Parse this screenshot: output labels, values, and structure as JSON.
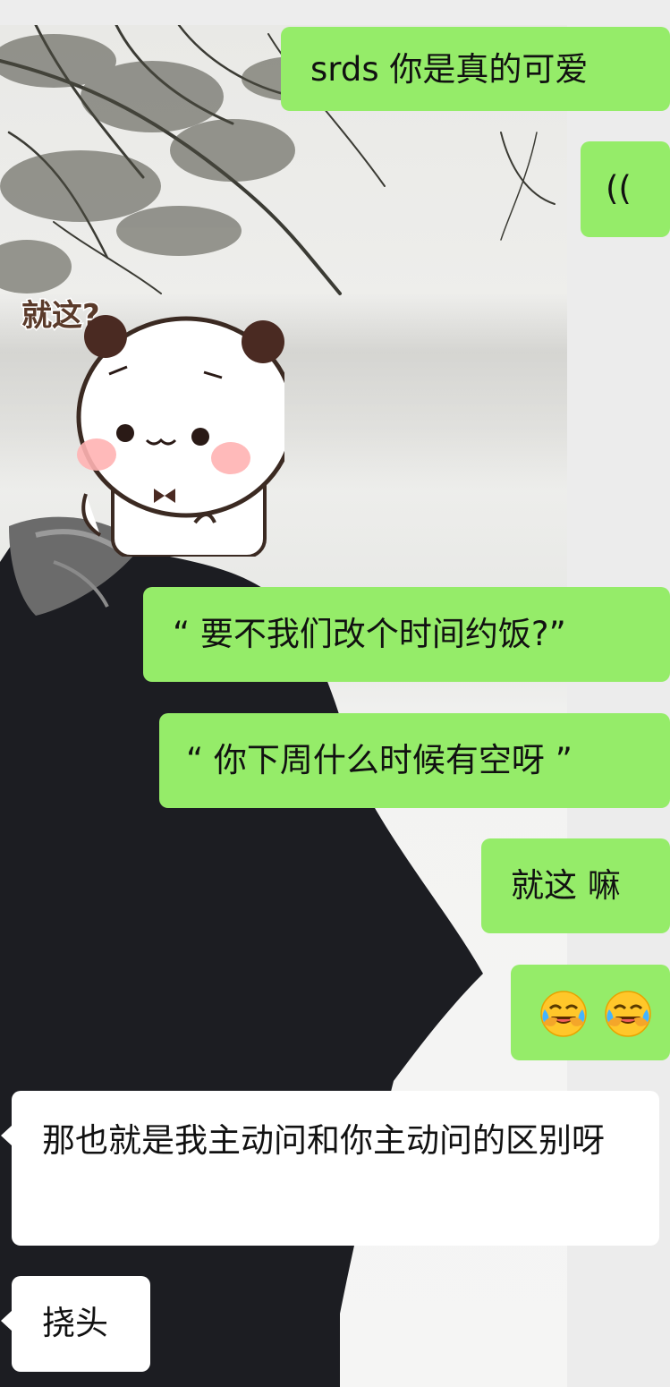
{
  "messages": [
    {
      "id": "m1",
      "side": "out",
      "text": "srds 你是真的可爱"
    },
    {
      "id": "m2",
      "side": "out",
      "text": "(("
    },
    {
      "id": "m3",
      "side": "in",
      "type": "sticker",
      "text": "就这?"
    },
    {
      "id": "m4",
      "side": "out",
      "text": "“ 要不我们改个时间约饭?”"
    },
    {
      "id": "m5",
      "side": "out",
      "text": "“ 你下周什么时候有空呀 ”"
    },
    {
      "id": "m6",
      "side": "out",
      "text": "就这  嘛"
    },
    {
      "id": "m7",
      "side": "out",
      "type": "emoji",
      "emoji": [
        "crying-laughing-face-icon",
        "crying-laughing-face-icon"
      ]
    },
    {
      "id": "m8",
      "side": "in",
      "text": "那也就是我主动问和你主动问的区别呀"
    },
    {
      "id": "m9",
      "side": "in",
      "text": "挠头"
    }
  ],
  "colors": {
    "outgoing_bubble": "#95ec69",
    "incoming_bubble": "#ffffff",
    "background": "#ececec"
  }
}
